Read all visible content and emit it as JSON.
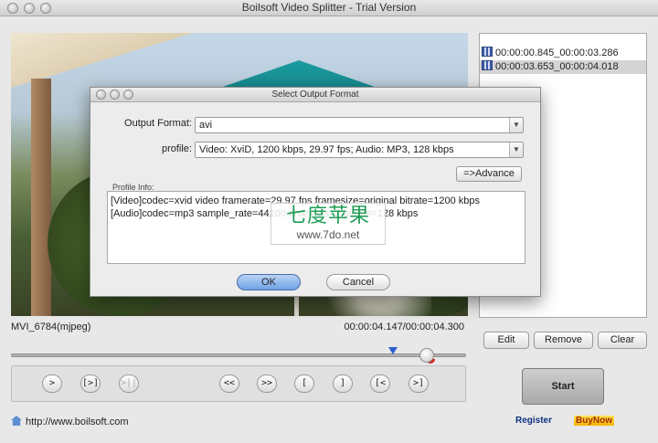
{
  "window": {
    "title": "Boilsoft Video Splitter - Trial Version"
  },
  "player": {
    "clip_name": "MVI_6784(mjpeg)",
    "time_readout": "00:00:04.147/00:00:04.300",
    "position_fraction": 0.914
  },
  "controls": {
    "play": ">",
    "play_segment": "[>]",
    "pause": ">||",
    "rewind": "<<",
    "forward": ">>",
    "mark_start": "[",
    "mark_end": "]",
    "go_start": "[<",
    "go_end": ">]"
  },
  "website": "http://www.boilsoft.com",
  "segments": [
    "00:00:00.845_00:00:03.286",
    "00:00:03.653_00:00:04.018"
  ],
  "segment_buttons": {
    "edit": "Edit",
    "remove": "Remove",
    "clear": "Clear"
  },
  "start_label": "Start",
  "register_label": "Register",
  "buynow_label": "BuyNow",
  "dialog": {
    "title": "Select Output Format",
    "output_format_label": "Output Format:",
    "output_format_value": "avi",
    "profile_label": "profile:",
    "profile_value": "Video: XviD, 1200 kbps, 29.97 fps;  Audio: MP3, 128 kbps",
    "advance_label": "=>Advance",
    "profile_info_label": "Profile Info:",
    "profile_info_lines": [
      "[Video]codec=xvid video framerate=29.97 fps framesize=original bitrate=1200 kbps",
      "[Audio]codec=mp3 sample_rate=44100 channels=2 bitrate=128 kbps"
    ],
    "ok_label": "OK",
    "cancel_label": "Cancel"
  },
  "watermark": {
    "top": "七度苹果",
    "bottom": "www.7do.net"
  }
}
